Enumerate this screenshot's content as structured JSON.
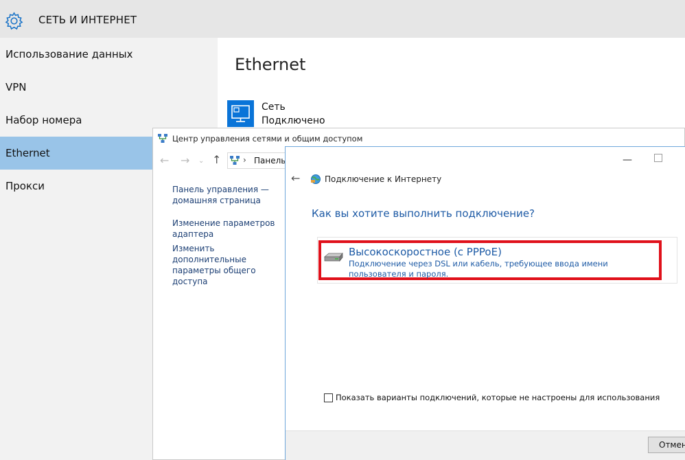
{
  "settings": {
    "header_title": "СЕТЬ И ИНТЕРНЕТ",
    "sidebar": [
      {
        "label": "Использование данных"
      },
      {
        "label": "VPN"
      },
      {
        "label": "Набор номера"
      },
      {
        "label": "Ethernet",
        "active": true
      },
      {
        "label": "Прокси"
      }
    ],
    "main": {
      "heading": "Ethernet",
      "network_name": "Сеть",
      "network_status": "Подключено"
    }
  },
  "network_center": {
    "title": "Центр управления сетями и общим доступом",
    "address": "Панель у",
    "links": [
      "Панель управления — домашняя страница",
      "Изменение параметров адаптера",
      "Изменить дополнительные параметры общего доступа"
    ]
  },
  "dialog": {
    "title": "Подключение к Интернету",
    "question": "Как вы хотите выполнить подключение?",
    "option_title": "Высокоскоростное (с PPPoE)",
    "option_description": "Подключение через DSL или кабель, требующее ввода имени пользователя и пароля.",
    "checkbox_label": "Показать варианты подключений, которые не настроены для использования",
    "checkbox_checked": false,
    "cancel_label": "Отмена",
    "minimize_glyph": "—"
  },
  "colors": {
    "accent_blue": "#0a74d8",
    "sidebar_selected": "#99c4e8",
    "link_blue": "#1d5aa5",
    "highlight_red": "#e0111b"
  }
}
